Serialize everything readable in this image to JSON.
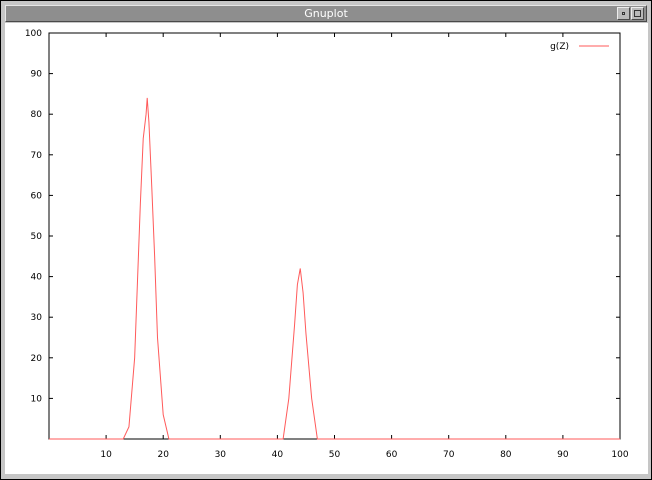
{
  "window": {
    "title": "Gnuplot"
  },
  "icons": {
    "minimize": "minimize-icon",
    "maximize": "maximize-icon"
  },
  "chart_data": {
    "type": "line",
    "title": "",
    "xlabel": "",
    "ylabel": "",
    "xlim": [
      0,
      100
    ],
    "ylim": [
      0,
      100
    ],
    "grid": false,
    "legend_position": "top-right",
    "xticks": [
      10,
      20,
      30,
      40,
      50,
      60,
      70,
      80,
      90,
      100
    ],
    "yticks": [
      10,
      20,
      30,
      40,
      50,
      60,
      70,
      80,
      90,
      100
    ],
    "series": [
      {
        "name": "g(Z)",
        "color": "#ff5a5a",
        "x": [
          0,
          13,
          14,
          15,
          16,
          16.5,
          17,
          17.2,
          17.5,
          18,
          18.5,
          19,
          20,
          21,
          40,
          41,
          42,
          43,
          43.5,
          44,
          44.5,
          45,
          46,
          47,
          48,
          100
        ],
        "y": [
          0,
          0,
          3,
          20,
          58,
          74,
          80,
          84,
          78,
          62,
          45,
          25,
          6,
          0,
          0,
          0,
          10,
          28,
          38,
          42,
          36,
          26,
          10,
          0,
          0,
          0
        ]
      }
    ]
  }
}
